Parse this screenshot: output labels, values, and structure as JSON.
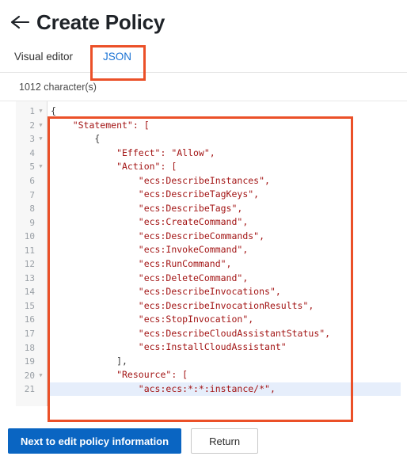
{
  "header": {
    "back_icon": "arrow-left-icon",
    "title": "Create Policy"
  },
  "tabs": [
    {
      "label": "Visual editor",
      "active": false
    },
    {
      "label": "JSON",
      "active": true
    }
  ],
  "editor": {
    "char_count_label": "1012 character(s)",
    "highlight_line": 21,
    "fold_lines": [
      1,
      2,
      3,
      5,
      20
    ],
    "lines": [
      {
        "n": 1,
        "text": "{"
      },
      {
        "n": 2,
        "text": "    \"Statement\": ["
      },
      {
        "n": 3,
        "text": "        {"
      },
      {
        "n": 4,
        "text": "            \"Effect\": \"Allow\","
      },
      {
        "n": 5,
        "text": "            \"Action\": ["
      },
      {
        "n": 6,
        "text": "                \"ecs:DescribeInstances\","
      },
      {
        "n": 7,
        "text": "                \"ecs:DescribeTagKeys\","
      },
      {
        "n": 8,
        "text": "                \"ecs:DescribeTags\","
      },
      {
        "n": 9,
        "text": "                \"ecs:CreateCommand\","
      },
      {
        "n": 10,
        "text": "                \"ecs:DescribeCommands\","
      },
      {
        "n": 11,
        "text": "                \"ecs:InvokeCommand\","
      },
      {
        "n": 12,
        "text": "                \"ecs:RunCommand\","
      },
      {
        "n": 13,
        "text": "                \"ecs:DeleteCommand\","
      },
      {
        "n": 14,
        "text": "                \"ecs:DescribeInvocations\","
      },
      {
        "n": 15,
        "text": "                \"ecs:DescribeInvocationResults\","
      },
      {
        "n": 16,
        "text": "                \"ecs:StopInvocation\","
      },
      {
        "n": 17,
        "text": "                \"ecs:DescribeCloudAssistantStatus\","
      },
      {
        "n": 18,
        "text": "                \"ecs:InstallCloudAssistant\""
      },
      {
        "n": 19,
        "text": "            ],"
      },
      {
        "n": 20,
        "text": "            \"Resource\": ["
      },
      {
        "n": 21,
        "text": "                \"acs:ecs:*:*:instance/*\","
      }
    ]
  },
  "footer": {
    "primary_label": "Next to edit policy information",
    "secondary_label": "Return"
  },
  "annotations": [
    {
      "name": "json-tab-highlight"
    },
    {
      "name": "json-editor-highlight"
    }
  ],
  "colors": {
    "accent_blue": "#0a65c2",
    "tab_active_blue": "#1a72d4",
    "annotation_orange": "#eb5028",
    "code_string_red": "#a31515",
    "highlight_row": "#e6eefb"
  }
}
